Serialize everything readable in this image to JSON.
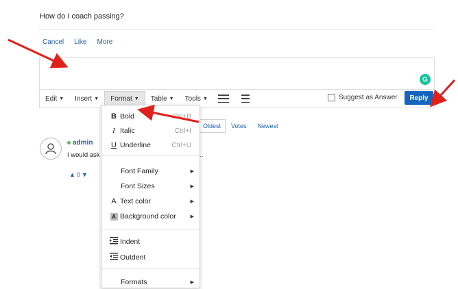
{
  "question": "How do I coach passing?",
  "actions": [
    "Cancel",
    "Like",
    "More"
  ],
  "grammarly_letter": "G",
  "toolbar": {
    "edit": "Edit",
    "insert": "Insert",
    "format": "Format",
    "table": "Table",
    "tools": "Tools"
  },
  "suggest_label": "Suggest as Answer",
  "reply_label": "Reply",
  "sort": {
    "oldest": "Oldest",
    "votes": "Votes",
    "newest": "Newest"
  },
  "comment": {
    "author": "admin",
    "text": "I would ask",
    "ellipsis": "t...",
    "vote_count": "0"
  },
  "format_menu": {
    "bold": {
      "icon": "B",
      "label": "Bold",
      "shortcut": "Ctrl+B"
    },
    "italic": {
      "icon": "I",
      "label": "Italic",
      "shortcut": "Ctrl+I"
    },
    "underline": {
      "icon": "U",
      "label": "Underline",
      "shortcut": "Ctrl+U"
    },
    "font_family": "Font Family",
    "font_sizes": "Font Sizes",
    "text_color": {
      "icon": "A",
      "label": "Text color"
    },
    "background_color": {
      "icon": "A",
      "label": "Background color"
    },
    "indent": "Indent",
    "outdent": "Outdent",
    "formats": "Formats"
  },
  "colors": {
    "accent": "#1565c0",
    "annotation_arrow": "#e0201b",
    "grammarly": "#15c39a"
  }
}
